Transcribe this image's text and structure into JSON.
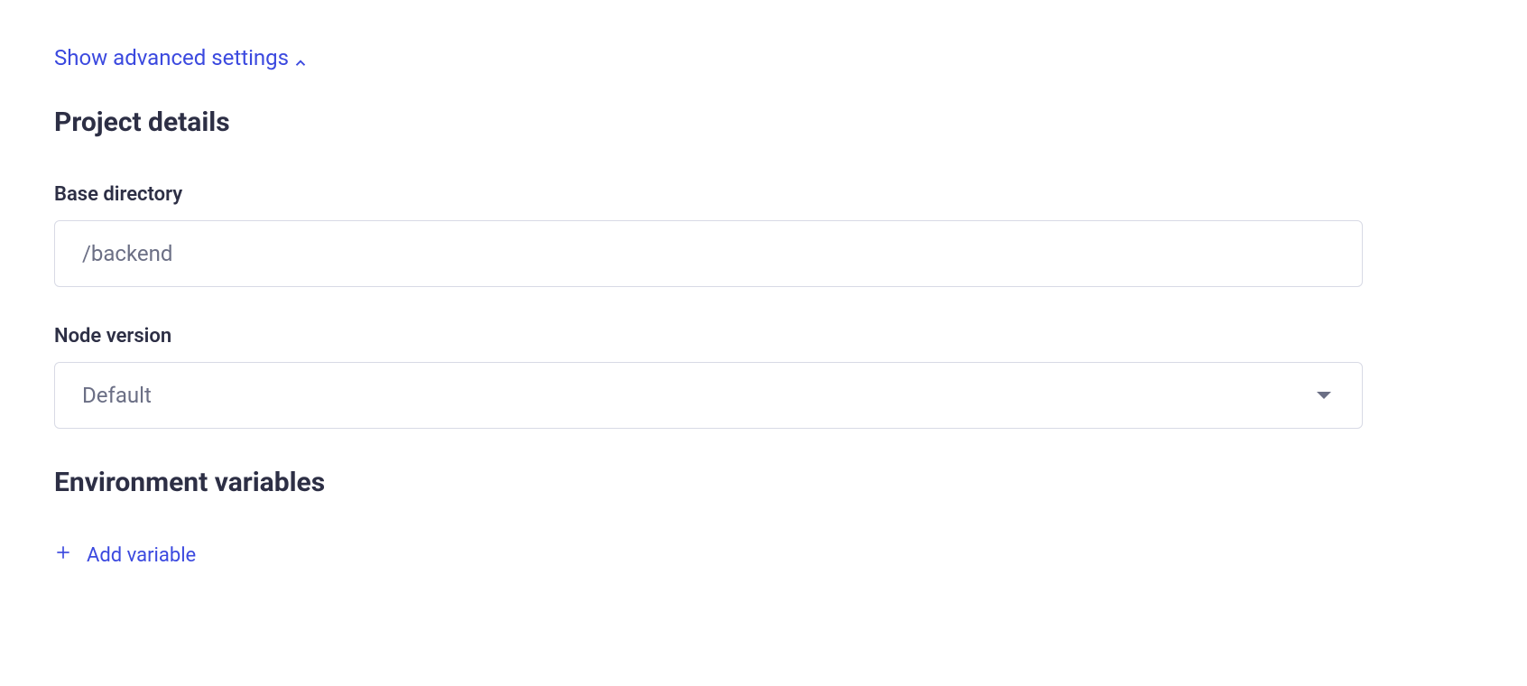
{
  "toggle": {
    "label": "Show advanced settings"
  },
  "project_details": {
    "heading": "Project details",
    "base_directory": {
      "label": "Base directory",
      "value": "/backend"
    },
    "node_version": {
      "label": "Node version",
      "selected": "Default"
    }
  },
  "environment_variables": {
    "heading": "Environment variables",
    "add_button_label": "Add variable"
  }
}
